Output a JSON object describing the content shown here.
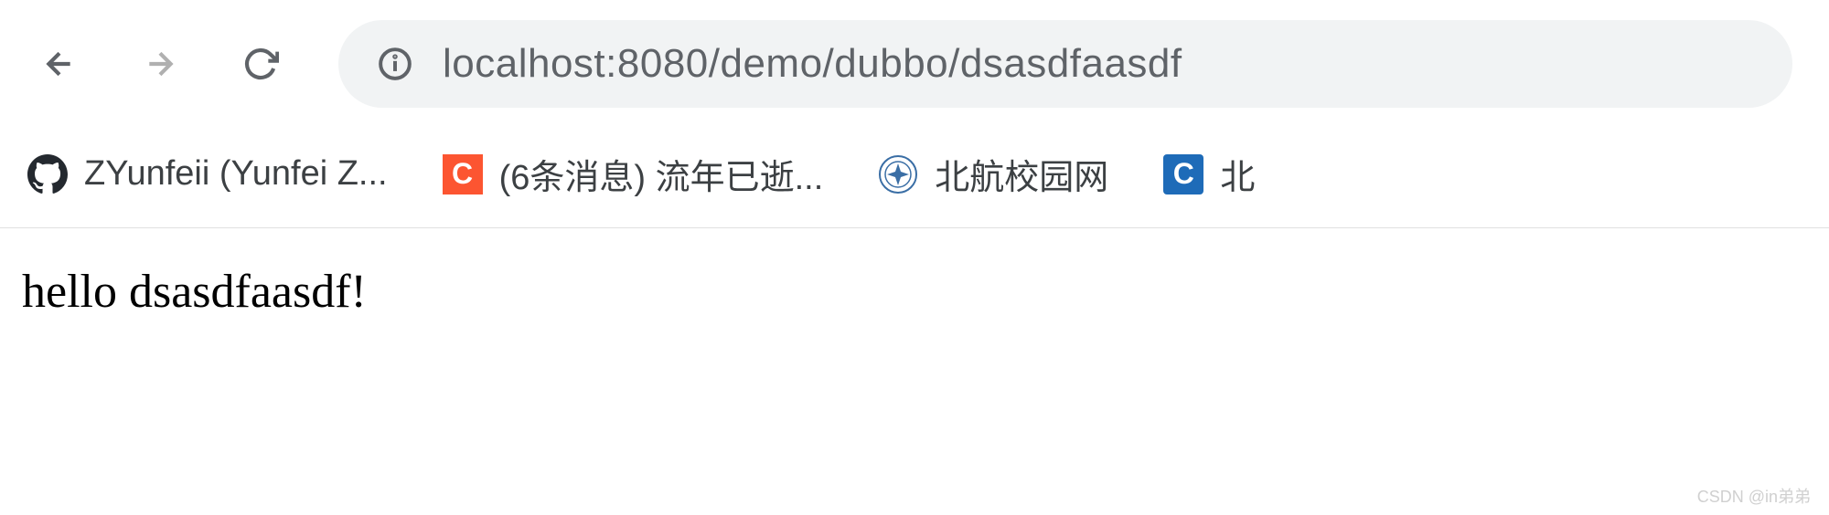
{
  "address_bar": {
    "url": "localhost:8080/demo/dubbo/dsasdfaasdf"
  },
  "bookmarks": [
    {
      "label": "ZYunfeii (Yunfei Z...",
      "icon": "github"
    },
    {
      "label": "(6条消息) 流年已逝...",
      "icon": "csdn-red"
    },
    {
      "label": "北航校园网",
      "icon": "buaa"
    },
    {
      "label": "北",
      "icon": "csdn-blue"
    }
  ],
  "page": {
    "body_text": "hello dsasdfaasdf!"
  },
  "watermark": "CSDN @in弟弟"
}
